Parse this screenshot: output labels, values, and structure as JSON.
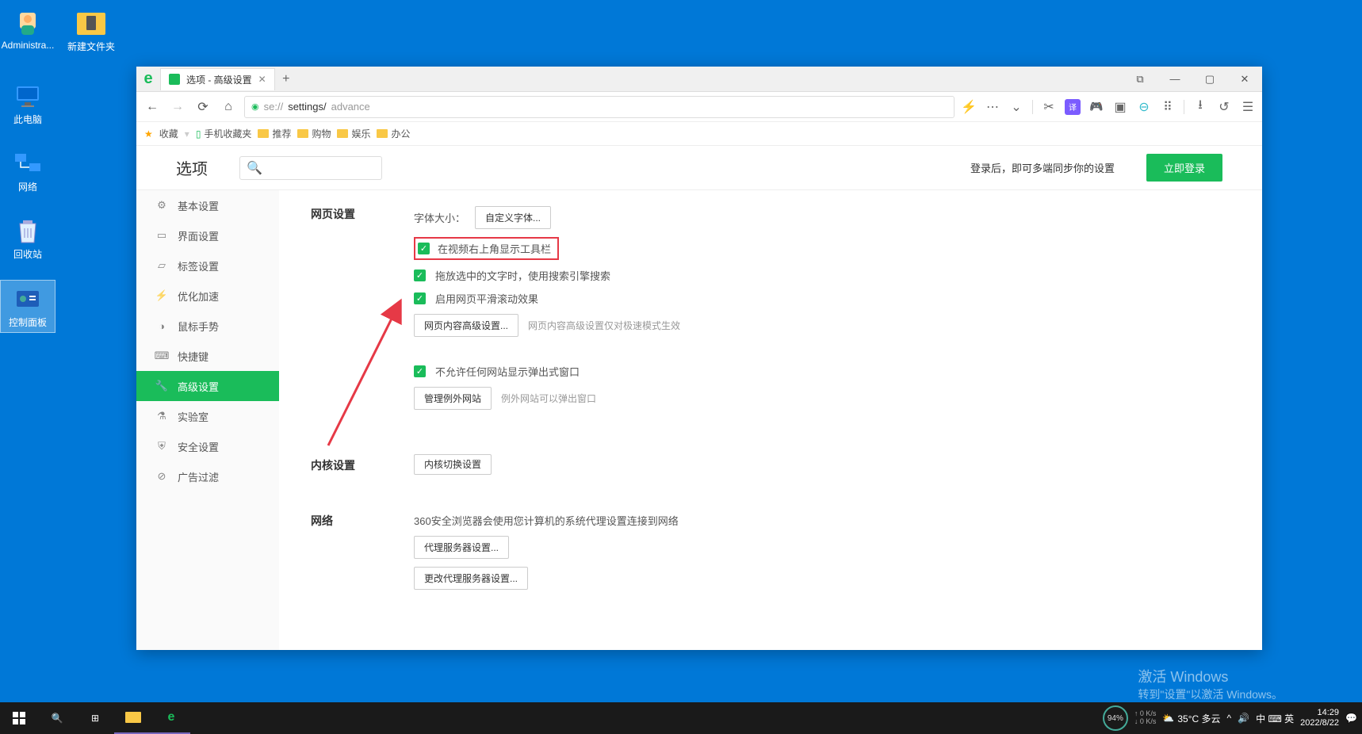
{
  "desktop": {
    "icons": [
      "Administra...",
      "新建文件夹",
      "此电脑",
      "网络",
      "回收站",
      "控制面板"
    ]
  },
  "browser": {
    "tab_title": "选项 - 高级设置",
    "url_prefix": "se://",
    "url_mid": "settings/",
    "url_end": "advance",
    "bookmarks": {
      "fav": "收藏",
      "mobile": "手机收藏夹",
      "items": [
        "推荐",
        "购物",
        "娱乐",
        "办公"
      ]
    },
    "page_title": "选项",
    "sync_text": "登录后，即可多端同步你的设置",
    "login_btn": "立即登录",
    "sidebar": [
      "基本设置",
      "界面设置",
      "标签设置",
      "优化加速",
      "鼠标手势",
      "快捷键",
      "高级设置",
      "实验室",
      "安全设置",
      "广告过滤"
    ],
    "sections": {
      "page": {
        "title": "网页设置",
        "font_label": "字体大小：",
        "font_btn": "自定义字体...",
        "chk1": "在视频右上角显示工具栏",
        "chk2": "拖放选中的文字时，使用搜索引擎搜索",
        "chk3": "启用网页平滑滚动效果",
        "adv_btn": "网页内容高级设置...",
        "adv_hint": "网页内容高级设置仅对极速模式生效",
        "chk4": "不允许任何网站显示弹出式窗口",
        "except_btn": "管理例外网站",
        "except_hint": "例外网站可以弹出窗口"
      },
      "kernel": {
        "title": "内核设置",
        "btn": "内核切换设置"
      },
      "network": {
        "title": "网络",
        "desc": "360安全浏览器会使用您计算机的系统代理设置连接到网络",
        "btn1": "代理服务器设置...",
        "btn2": "更改代理服务器设置..."
      }
    }
  },
  "watermark": {
    "t1": "激活 Windows",
    "t2": "转到\"设置\"以激活 Windows。"
  },
  "taskbar": {
    "weather": "35°C 多云",
    "circle": "94%",
    "net_up": "0 K/s",
    "net_dn": "0 K/s",
    "ime": "中 ⌨ 英",
    "time": "14:29",
    "date": "2022/8/22"
  }
}
